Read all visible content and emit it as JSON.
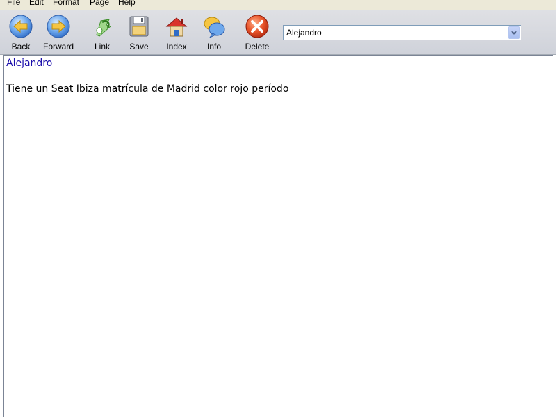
{
  "menu": [
    "File",
    "Edit",
    "Format",
    "Page",
    "Help"
  ],
  "toolbar": {
    "buttons": [
      {
        "label": "Back",
        "icon": "arrow-left-icon"
      },
      {
        "label": "Forward",
        "icon": "arrow-right-icon"
      },
      {
        "label": "Link",
        "icon": "link-icon"
      },
      {
        "label": "Save",
        "icon": "floppy-disk-icon"
      },
      {
        "label": "Index",
        "icon": "home-icon"
      },
      {
        "label": "Info",
        "icon": "info-bubbles-icon"
      },
      {
        "label": "Delete",
        "icon": "delete-x-icon"
      }
    ],
    "page_select": {
      "value": "Alejandro"
    }
  },
  "page": {
    "link_text": "Alejandro",
    "body_text": "Tiene un Seat Ibiza matrícula de Madrid color rojo período"
  },
  "colors": {
    "link": "#1a0dab",
    "toolbar_bg": "#d6d8de",
    "menubar_bg": "#ece9d8"
  }
}
